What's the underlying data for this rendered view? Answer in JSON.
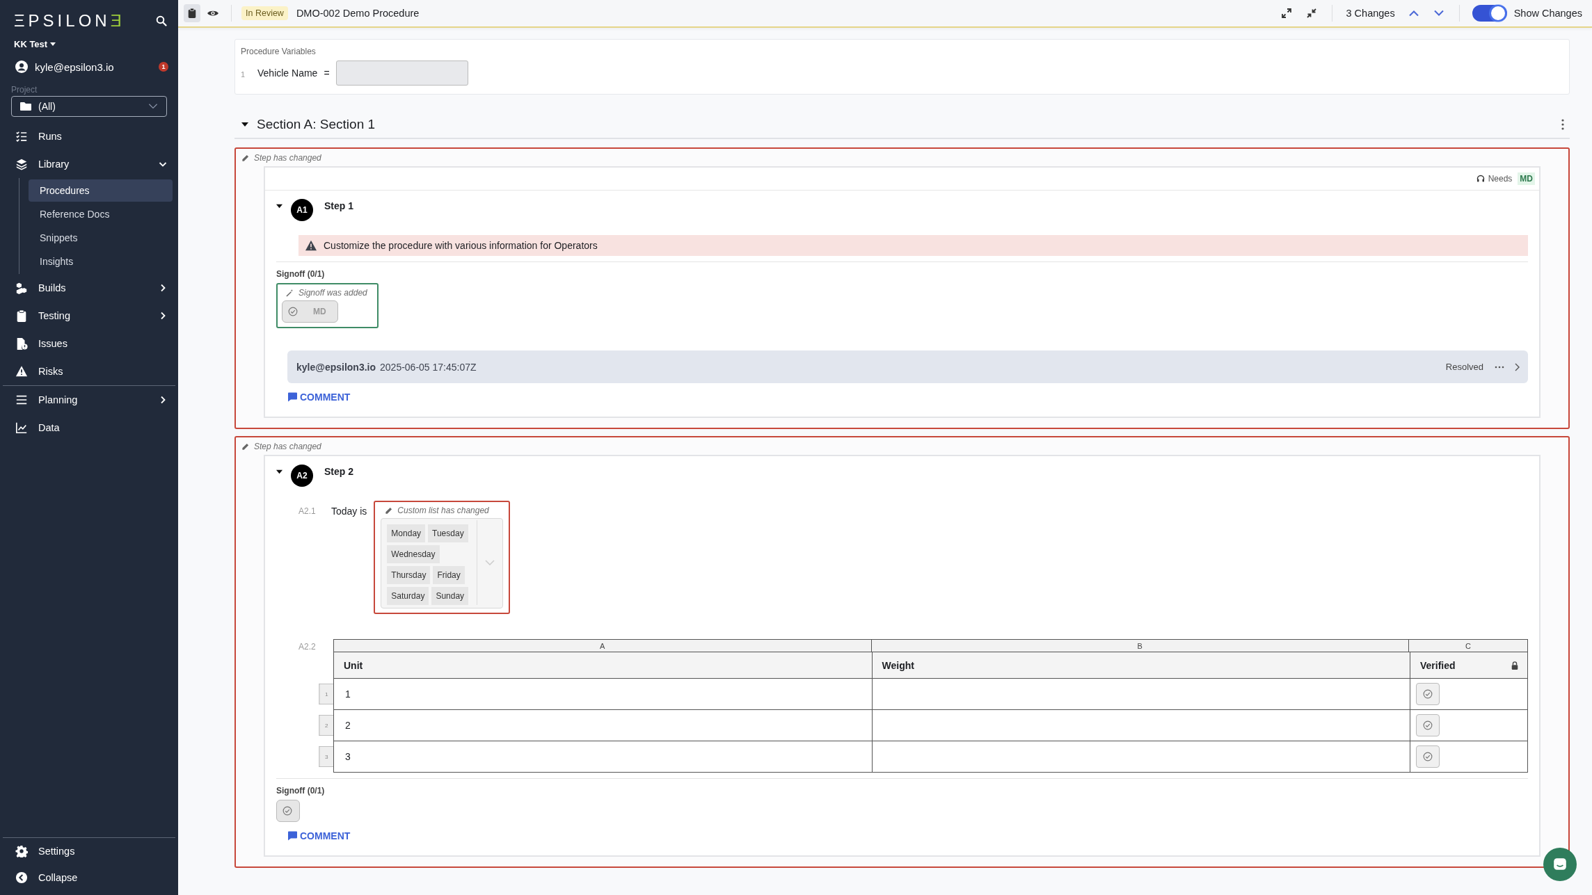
{
  "sidebar": {
    "logo_text": "ΞPSILON",
    "logo_accent": "Ǝ",
    "workspace": "KK Test",
    "user": "kyle@epsilon3.io",
    "notification_count": "1",
    "project_label": "Project",
    "project_value": "(All)",
    "nav_groups": [
      [
        {
          "label": "Runs"
        },
        {
          "label": "Library",
          "expanded": true,
          "children": [
            {
              "label": "Procedures",
              "selected": true
            },
            {
              "label": "Reference Docs",
              "selected": false
            },
            {
              "label": "Snippets",
              "selected": false
            },
            {
              "label": "Insights",
              "selected": false
            }
          ]
        },
        {
          "label": "Builds",
          "expanded": false
        },
        {
          "label": "Testing",
          "expanded": false
        },
        {
          "label": "Issues"
        },
        {
          "label": "Risks"
        }
      ],
      [
        {
          "label": "Planning",
          "expanded": false
        },
        {
          "label": "Data"
        }
      ]
    ],
    "footer": [
      {
        "label": "Settings"
      },
      {
        "label": "Collapse"
      }
    ]
  },
  "top_bar": {
    "status": "In Review",
    "title": "DMO-002 Demo Procedure",
    "changes": "3 Changes",
    "show_changes": {
      "label": "Show Changes",
      "on": true
    }
  },
  "procedure_variables": {
    "title": "Procedure Variables",
    "items": [
      {
        "index": "1",
        "name": "Vehicle Name",
        "operator": "="
      }
    ]
  },
  "section": {
    "title": "Section A: Section 1",
    "expanded": true,
    "steps": [
      {
        "change": {
          "kind": "modified",
          "note": "Step has changed"
        },
        "requires": {
          "label": "Needs",
          "role": "MD"
        },
        "badge": "A1",
        "title": "Step 1",
        "expanded": true,
        "content": [
          {
            "kind": "caution",
            "text": "Customize the procedure with various information for Operators"
          }
        ],
        "signoff": {
          "label": "Signoff (0/1)",
          "change": {
            "kind": "added",
            "note": "Signoff was added"
          },
          "roles": [
            "MD"
          ]
        },
        "comments": [
          {
            "author": "kyle@epsilon3.io",
            "time": "2025-06-05 17:45:07Z",
            "status": "Resolved"
          }
        ],
        "comment_button": "COMMENT"
      },
      {
        "change": {
          "kind": "modified",
          "note": "Step has changed"
        },
        "badge": "A2",
        "title": "Step 2",
        "expanded": true,
        "content": [
          {
            "kind": "multi_select",
            "index": "A2.1",
            "label": "Today is",
            "change": {
              "kind": "modified",
              "note": "Custom list has changed"
            },
            "option_rows": [
              [
                "Monday",
                "Tuesday"
              ],
              [
                "Wednesday"
              ],
              [
                "Thursday",
                "Friday"
              ],
              [
                "Saturday",
                "Sunday"
              ]
            ]
          },
          {
            "kind": "table",
            "index": "A2.2",
            "column_letters": [
              "A",
              "B",
              "C"
            ],
            "columns": [
              {
                "name": "Unit",
                "kind": "text",
                "locked": false
              },
              {
                "name": "Weight",
                "kind": "text",
                "locked": false
              },
              {
                "name": "Verified",
                "kind": "check",
                "locked": true
              }
            ],
            "rows": [
              {
                "number": "1",
                "values": [
                  "1"
                ]
              },
              {
                "number": "2",
                "values": [
                  "2"
                ]
              },
              {
                "number": "3",
                "values": [
                  "3"
                ]
              }
            ]
          }
        ],
        "signoff": {
          "label": "Signoff (0/1)"
        },
        "comment_button": "COMMENT"
      }
    ]
  }
}
